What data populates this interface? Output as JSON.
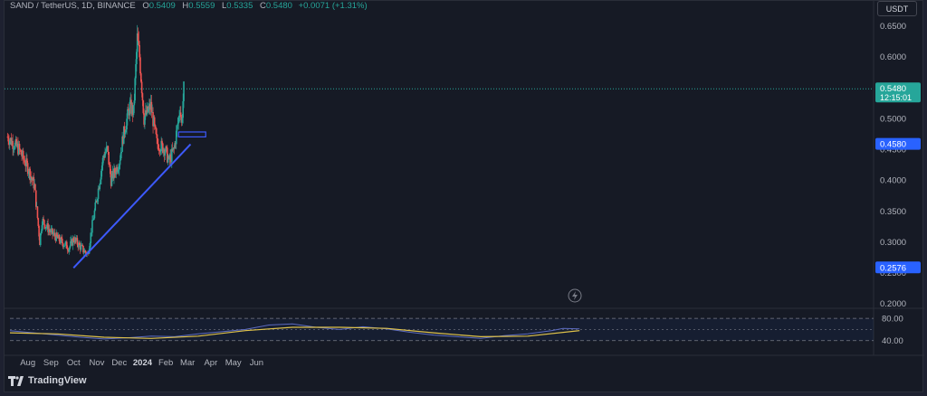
{
  "header": {
    "symbol": "SAND / TetherUS, 1D, BINANCE",
    "open_label": "O",
    "open": "0.5409",
    "high_label": "H",
    "high": "0.5559",
    "low_label": "L",
    "low": "0.5335",
    "close_label": "C",
    "close": "0.5480",
    "change": "+0.0071 (+1.31%)"
  },
  "currency_button": "USDT",
  "brand": "TradingView",
  "colors": {
    "up": "#26a69a",
    "down": "#ef5350",
    "trendline": "#3d5afe",
    "rsi": "#e0c34a",
    "rsi_ma": "#5c6bc0",
    "price_line": "#26a69a",
    "background": "#161a25"
  },
  "chart_data": {
    "type": "candlestick",
    "symbol": "SAND / TetherUS",
    "interval": "1D",
    "exchange": "BINANCE",
    "price_axis": {
      "ticks": [
        "0.6500",
        "0.6000",
        "0.5500",
        "0.5000",
        "0.4500",
        "0.4000",
        "0.3500",
        "0.3000",
        "0.2500",
        "0.2000"
      ],
      "range": [
        0.195,
        0.67
      ]
    },
    "time_axis": {
      "ticks": [
        "Aug",
        "Sep",
        "Oct",
        "Nov",
        "Dec",
        "2024",
        "Feb",
        "Mar",
        "Apr",
        "May",
        "Jun"
      ]
    },
    "price_labels": [
      {
        "value": "0.5480",
        "sub": "12:15:01",
        "kind": "last-price"
      },
      {
        "value": "0.4580",
        "kind": "trendline-level"
      },
      {
        "value": "0.2576",
        "kind": "trendline-start"
      }
    ],
    "series_close_approx": [
      [
        "2023-07-05",
        0.47
      ],
      [
        "2023-07-20",
        0.45
      ],
      [
        "2023-08-01",
        0.42
      ],
      [
        "2023-08-10",
        0.39
      ],
      [
        "2023-08-17",
        0.3
      ],
      [
        "2023-08-20",
        0.335
      ],
      [
        "2023-09-01",
        0.315
      ],
      [
        "2023-09-10",
        0.305
      ],
      [
        "2023-09-25",
        0.29
      ],
      [
        "2023-10-01",
        0.305
      ],
      [
        "2023-10-15",
        0.285
      ],
      [
        "2023-10-20",
        0.28
      ],
      [
        "2023-10-25",
        0.32
      ],
      [
        "2023-11-01",
        0.37
      ],
      [
        "2023-11-10",
        0.44
      ],
      [
        "2023-11-15",
        0.45
      ],
      [
        "2023-11-20",
        0.4
      ],
      [
        "2023-12-01",
        0.43
      ],
      [
        "2023-12-06",
        0.47
      ],
      [
        "2023-12-15",
        0.52
      ],
      [
        "2023-12-20",
        0.51
      ],
      [
        "2023-12-25",
        0.63
      ],
      [
        "2023-12-28",
        0.6
      ],
      [
        "2024-01-03",
        0.5
      ],
      [
        "2024-01-12",
        0.52
      ],
      [
        "2024-01-20",
        0.46
      ],
      [
        "2024-01-31",
        0.45
      ],
      [
        "2024-02-05",
        0.43
      ],
      [
        "2024-02-12",
        0.45
      ],
      [
        "2024-02-18",
        0.5
      ],
      [
        "2024-02-20",
        0.52
      ],
      [
        "2024-02-22",
        0.49
      ],
      [
        "2024-02-25",
        0.548
      ]
    ],
    "trendline": {
      "from": [
        "2023-10-01",
        0.2576
      ],
      "to": [
        "2024-03-05",
        0.458
      ]
    },
    "rsi": {
      "levels": [
        "80.00",
        "40.00"
      ],
      "values_approx": [
        [
          0,
          58
        ],
        [
          10,
          54
        ],
        [
          20,
          50
        ],
        [
          30,
          46
        ],
        [
          40,
          43
        ],
        [
          50,
          45
        ],
        [
          60,
          48
        ],
        [
          70,
          47
        ],
        [
          80,
          52
        ],
        [
          90,
          56
        ],
        [
          100,
          60
        ],
        [
          110,
          68
        ],
        [
          120,
          70
        ],
        [
          130,
          64
        ],
        [
          140,
          60
        ],
        [
          150,
          65
        ],
        [
          160,
          61
        ],
        [
          170,
          55
        ],
        [
          180,
          50
        ],
        [
          190,
          47
        ],
        [
          200,
          44
        ],
        [
          210,
          49
        ],
        [
          220,
          52
        ],
        [
          230,
          58
        ],
        [
          235,
          62
        ],
        [
          242,
          61
        ]
      ],
      "ma_approx": [
        [
          0,
          54
        ],
        [
          20,
          52
        ],
        [
          40,
          46
        ],
        [
          60,
          44
        ],
        [
          80,
          48
        ],
        [
          100,
          58
        ],
        [
          120,
          64
        ],
        [
          140,
          64
        ],
        [
          160,
          62
        ],
        [
          180,
          54
        ],
        [
          200,
          47
        ],
        [
          220,
          48
        ],
        [
          242,
          58
        ]
      ]
    }
  }
}
